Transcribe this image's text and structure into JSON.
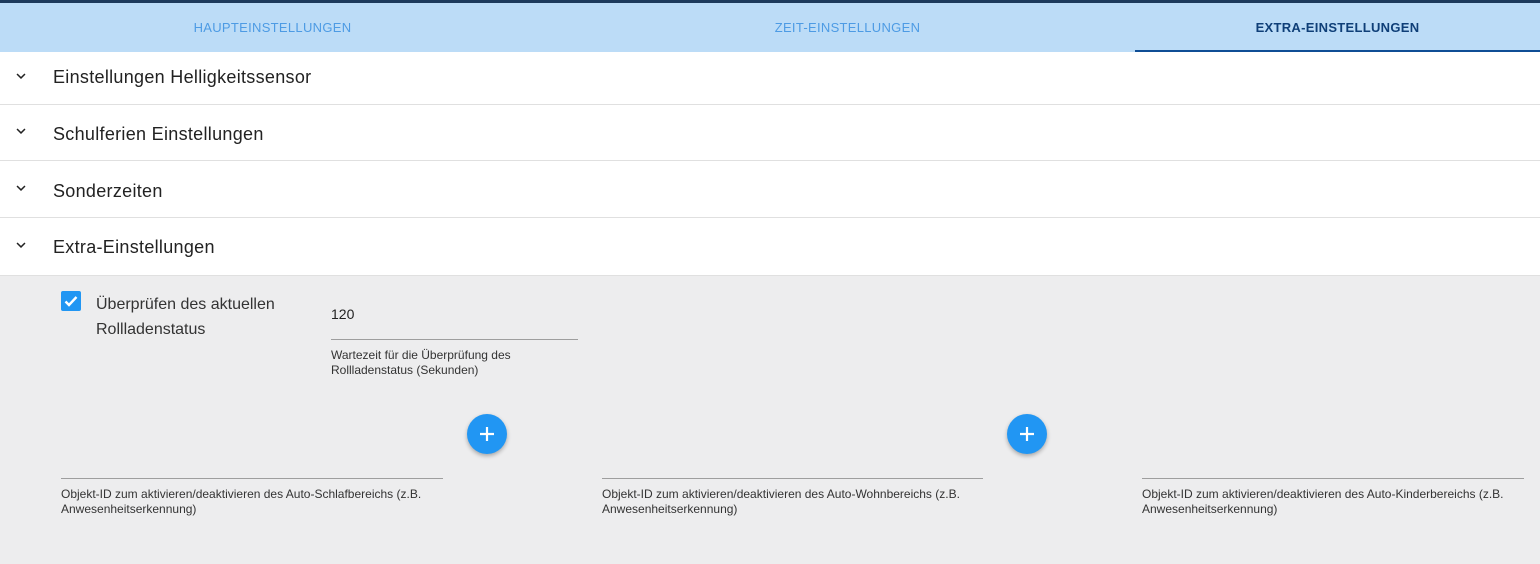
{
  "tabs": [
    {
      "label": "HAUPTEINSTELLUNGEN",
      "active": false
    },
    {
      "label": "ZEIT-EINSTELLUNGEN",
      "active": false
    },
    {
      "label": "EXTRA-EINSTELLUNGEN",
      "active": true
    }
  ],
  "panels": [
    {
      "title": "Einstellungen Helligkeitssensor",
      "icon": "chevron-down-icon"
    },
    {
      "title": "Schulferien Einstellungen",
      "icon": "chevron-down-icon"
    },
    {
      "title": "Sonderzeiten",
      "icon": "chevron-down-icon"
    },
    {
      "title": "Extra-Einstellungen",
      "icon": "chevron-down-icon"
    }
  ],
  "extra": {
    "check_status": {
      "label": "Überprüfen des aktuellen Rollladenstatus",
      "checked": true
    },
    "wait_time": {
      "value": "120",
      "helper": "Wartezeit für die Überprüfung des Rollladenstatus (Sekunden)"
    },
    "objects": [
      {
        "value": "",
        "helper": "Objekt-ID zum aktivieren/deaktivieren des Auto-Schlafbereichs (z.B. Anwesenheitserkennung)",
        "button_icon": "add-icon"
      },
      {
        "value": "",
        "helper": "Objekt-ID zum aktivieren/deaktivieren des Auto-Wohnbereichs (z.B. Anwesenheitserkennung)",
        "button_icon": "add-icon"
      },
      {
        "value": "",
        "helper": "Objekt-ID zum aktivieren/deaktivieren des Auto-Kinderbereichs (z.B. Anwesenheitserkennung)"
      }
    ]
  },
  "colors": {
    "accent": "#2196f3",
    "tab_bar": "#bcdcf7",
    "active_tab": "#0f3f78",
    "content_bg": "#ededee"
  }
}
